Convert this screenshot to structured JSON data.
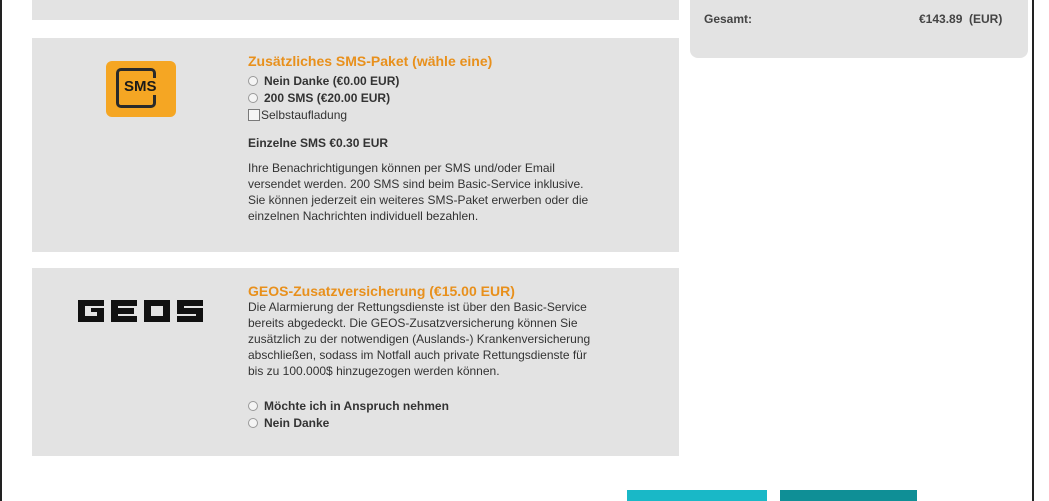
{
  "summary": {
    "total_label": "Gesamt:",
    "total_amount": "€143.89",
    "total_currency": "(EUR)"
  },
  "sms_package": {
    "icon_text": "SMS",
    "title": "Zusätzliches SMS-Paket (wähle eine)",
    "options": [
      "Nein Danke (€0.00 EUR)",
      "200 SMS (€20.00 EUR)"
    ],
    "auto_recharge_label": "Selbstaufladung",
    "single_price": "Einzelne SMS €0.30 EUR",
    "description_lines": [
      "Ihre Benachrichtigungen können per SMS und/oder Email",
      "versendet werden. 200 SMS sind beim Basic-Service inklusive.",
      "Sie können jederzeit ein weiteres SMS-Paket erwerben oder die",
      "einzelnen Nachrichten individuell bezahlen."
    ]
  },
  "geos": {
    "logo_text": "GEOS",
    "title": "GEOS-Zusatzversicherung (€15.00 EUR)",
    "description_lines": [
      "Die Alarmierung der Rettungsdienste ist über den Basic-Service",
      "bereits abgedeckt. Die GEOS-Zusatzversicherung können Sie",
      "zusätzlich zu der notwendigen (Auslands-) Krankenversicherung",
      "abschließen, sodass im Notfall auch private Rettungsdienste für",
      "bis zu 100.000$ hinzugezogen werden können."
    ],
    "options": [
      "Möchte ich in Anspruch nehmen",
      "Nein Danke"
    ]
  },
  "colors": {
    "panel_bg": "#e3e3e3",
    "accent_orange": "#e8901c",
    "sms_icon_bg": "#f5a623",
    "button_left": "#19b8c7",
    "button_right": "#0f8f96"
  }
}
